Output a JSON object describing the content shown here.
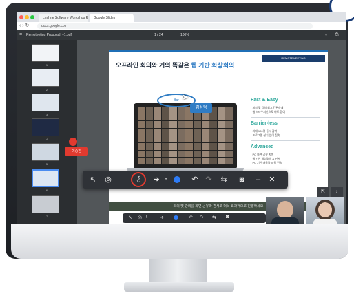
{
  "browser": {
    "tabs": [
      {
        "label": "Leshne Software Workshop Report"
      },
      {
        "label": "Google Slides"
      }
    ],
    "url": "docs.google.com"
  },
  "pdf_toolbar": {
    "filename": "Remoteeting Proposal_v1.pdf",
    "page_indicator": "1 / 24",
    "zoom": "100%"
  },
  "sidebar": {
    "page_numbers": [
      "1",
      "2",
      "3",
      "4",
      "5",
      "6",
      "7",
      "8",
      "9"
    ]
  },
  "slide": {
    "title_prefix": "오프라인 회의와 거의 똑같은 ",
    "title_highlight": "웹 기반 화상회의",
    "logo_text": "REMOTEMEETING",
    "ellipse_text": "Bar",
    "presenter_label": "김성혁",
    "sections": [
      {
        "title": "Fast & Easy",
        "lines": [
          "· 회의 및 강의 쉽고 간편하게",
          "· 웹 브라우저만으로 바로 참여"
        ]
      },
      {
        "title": "Barrier-less",
        "lines": [
          "· 최대 100명 동시 참여",
          "· 프로그램 설치 없이 접속"
        ]
      },
      {
        "title": "Advanced",
        "lines": [
          "· PC 화면 공유 지원",
          "· 웹 기반 화상회의 & 판서",
          "· PC 기반 대용량 파일 전송"
        ]
      }
    ]
  },
  "pointer_label": "이승진",
  "caption": "회의 및 강의를 화면 공유와 판서로 더욱 효과적으로 진행하세요",
  "annotation_toolbar": {
    "icons": [
      "cursor-icon",
      "target-icon",
      "pen-icon",
      "arrow-icon",
      "chevron-up-icon",
      "color-dot",
      "undo-icon",
      "redo-icon",
      "swap-icon",
      "camera-icon",
      "minimize-icon",
      "close-icon"
    ]
  },
  "video_tiles": [
    {
      "name": "man"
    },
    {
      "name": "woman"
    }
  ],
  "colors": {
    "accent_blue": "#2f7cc4",
    "accent_red": "#e23a2f",
    "teal": "#2fa89c"
  }
}
